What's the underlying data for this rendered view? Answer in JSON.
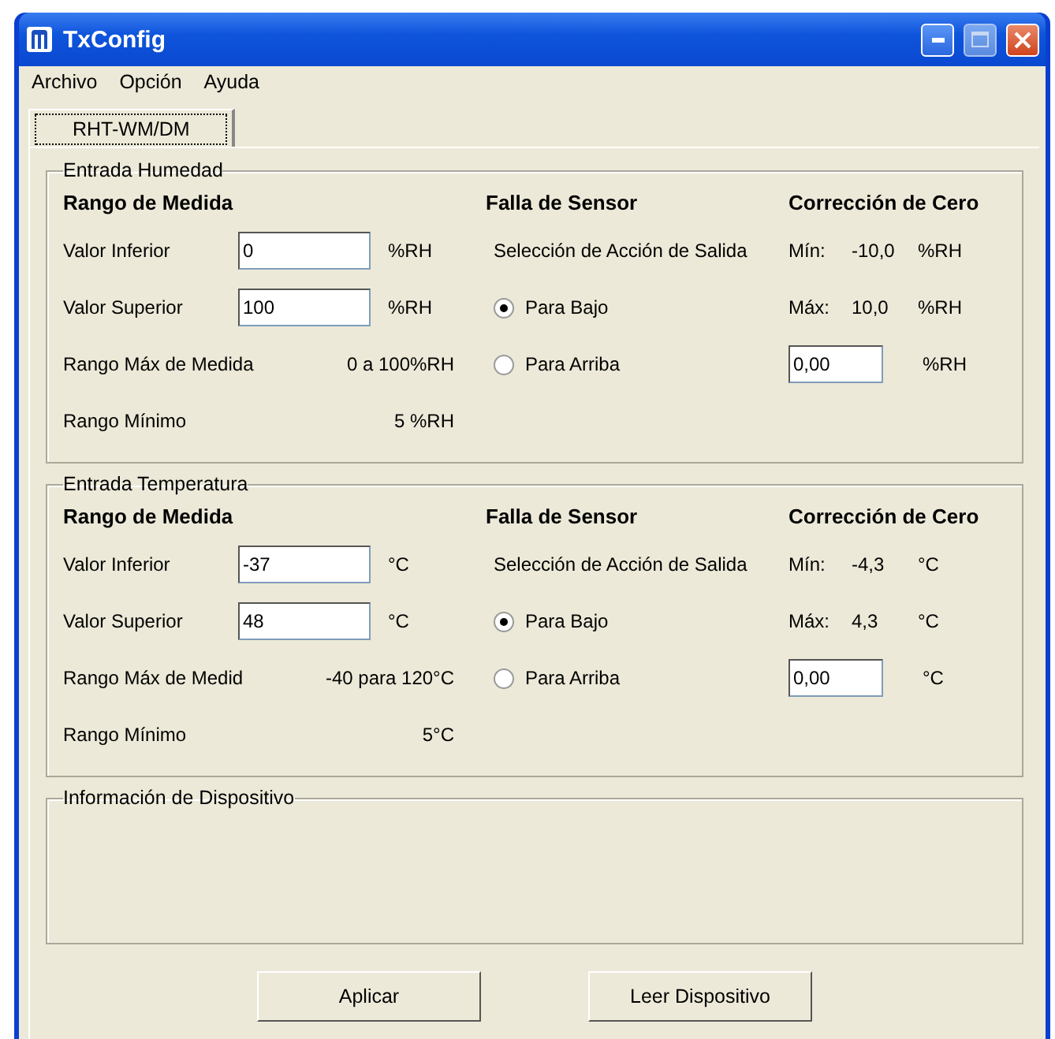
{
  "window": {
    "title": "TxConfig"
  },
  "menu": [
    {
      "label": "Archivo"
    },
    {
      "label": "Opción"
    },
    {
      "label": "Ayuda"
    }
  ],
  "tabs": [
    {
      "label": "RHT-WM/DM",
      "selected": true
    }
  ],
  "groups": [
    {
      "title": "Entrada Humedad",
      "range": {
        "heading": "Rango de Medida",
        "fields": [
          {
            "label": "Valor Inferior",
            "value": "0",
            "unit": "%RH"
          },
          {
            "label": "Valor Superior",
            "value": "100",
            "unit": "%RH"
          }
        ],
        "info": [
          {
            "label": "Rango Máx de Medida",
            "value": "0 a 100%RH"
          },
          {
            "label": "Rango Mínimo",
            "value": "5 %RH"
          }
        ]
      },
      "sensor_fault": {
        "heading": "Falla de Sensor",
        "caption": "Selección de Acción de Salida",
        "options": [
          {
            "label": "Para Bajo",
            "selected": true
          },
          {
            "label": "Para Arriba",
            "selected": false
          }
        ]
      },
      "zero_correction": {
        "heading": "Corrección de Cero",
        "limits": [
          {
            "label": "Mín:",
            "value": "-10,0",
            "unit": "%RH"
          },
          {
            "label": "Máx:",
            "value": "10,0",
            "unit": "%RH"
          }
        ],
        "offset": {
          "value": "0,00",
          "unit": "%RH"
        }
      }
    },
    {
      "title": "Entrada Temperatura",
      "range": {
        "heading": "Rango de Medida",
        "fields": [
          {
            "label": "Valor Inferior",
            "value": "-37",
            "unit": "°C"
          },
          {
            "label": "Valor Superior",
            "value": "48",
            "unit": "°C"
          }
        ],
        "info": [
          {
            "label": "Rango Máx de Medid",
            "value": "-40 para 120°C"
          },
          {
            "label": "Rango Mínimo",
            "value": "5°C"
          }
        ]
      },
      "sensor_fault": {
        "heading": "Falla de Sensor",
        "caption": "Selección de Acción de Salida",
        "options": [
          {
            "label": "Para Bajo",
            "selected": true
          },
          {
            "label": "Para Arriba",
            "selected": false
          }
        ]
      },
      "zero_correction": {
        "heading": "Corrección de Cero",
        "limits": [
          {
            "label": "Mín:",
            "value": "-4,3",
            "unit": "°C"
          },
          {
            "label": "Máx:",
            "value": "4,3",
            "unit": "°C"
          }
        ],
        "offset": {
          "value": "0,00",
          "unit": "°C"
        }
      }
    }
  ],
  "device_info": {
    "title": "Información de Dispositivo"
  },
  "buttons": [
    {
      "label": "Aplicar"
    },
    {
      "label": "Leer Dispositivo"
    }
  ]
}
